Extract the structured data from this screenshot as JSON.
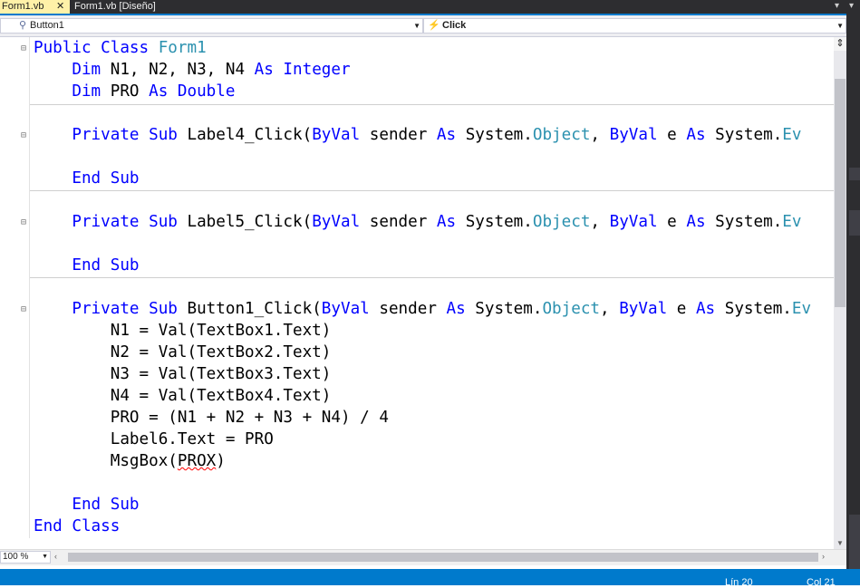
{
  "tabs": {
    "active_label": "Form1.vb",
    "close_glyph": "✕",
    "design_label": "Form1.vb [Diseño]",
    "menu_glyph": "▾"
  },
  "navbar": {
    "object_combo": {
      "icon": "button-control-icon",
      "value": "Button1"
    },
    "event_combo": {
      "icon": "lightning-event-icon",
      "value": "Click"
    }
  },
  "editor": {
    "lines": [
      [
        {
          "t": "Public ",
          "c": "kw"
        },
        {
          "t": "Class ",
          "c": "kw"
        },
        {
          "t": "Form1",
          "c": "ty"
        }
      ],
      [
        {
          "t": "    "
        },
        {
          "t": "Dim",
          "c": "kw"
        },
        {
          "t": " N1, N2, N3, N4 "
        },
        {
          "t": "As",
          "c": "kw"
        },
        {
          "t": " "
        },
        {
          "t": "Integer",
          "c": "kw"
        }
      ],
      [
        {
          "t": "    "
        },
        {
          "t": "Dim",
          "c": "kw"
        },
        {
          "t": " PRO "
        },
        {
          "t": "As",
          "c": "kw"
        },
        {
          "t": " "
        },
        {
          "t": "Double",
          "c": "kw"
        }
      ],
      [],
      [
        {
          "t": "    "
        },
        {
          "t": "Private",
          "c": "kw"
        },
        {
          "t": " "
        },
        {
          "t": "Sub",
          "c": "kw"
        },
        {
          "t": " Label4_Click("
        },
        {
          "t": "ByVal",
          "c": "kw"
        },
        {
          "t": " sender "
        },
        {
          "t": "As",
          "c": "kw"
        },
        {
          "t": " System."
        },
        {
          "t": "Object",
          "c": "ty"
        },
        {
          "t": ", "
        },
        {
          "t": "ByVal",
          "c": "kw"
        },
        {
          "t": " e "
        },
        {
          "t": "As",
          "c": "kw"
        },
        {
          "t": " System."
        },
        {
          "t": "Ev",
          "c": "ty"
        }
      ],
      [],
      [
        {
          "t": "    "
        },
        {
          "t": "End",
          "c": "kw"
        },
        {
          "t": " "
        },
        {
          "t": "Sub",
          "c": "kw"
        }
      ],
      [],
      [
        {
          "t": "    "
        },
        {
          "t": "Private",
          "c": "kw"
        },
        {
          "t": " "
        },
        {
          "t": "Sub",
          "c": "kw"
        },
        {
          "t": " Label5_Click("
        },
        {
          "t": "ByVal",
          "c": "kw"
        },
        {
          "t": " sender "
        },
        {
          "t": "As",
          "c": "kw"
        },
        {
          "t": " System."
        },
        {
          "t": "Object",
          "c": "ty"
        },
        {
          "t": ", "
        },
        {
          "t": "ByVal",
          "c": "kw"
        },
        {
          "t": " e "
        },
        {
          "t": "As",
          "c": "kw"
        },
        {
          "t": " System."
        },
        {
          "t": "Ev",
          "c": "ty"
        }
      ],
      [],
      [
        {
          "t": "    "
        },
        {
          "t": "End",
          "c": "kw"
        },
        {
          "t": " "
        },
        {
          "t": "Sub",
          "c": "kw"
        }
      ],
      [],
      [
        {
          "t": "    "
        },
        {
          "t": "Private",
          "c": "kw"
        },
        {
          "t": " "
        },
        {
          "t": "Sub",
          "c": "kw"
        },
        {
          "t": " Button1_Click("
        },
        {
          "t": "ByVal",
          "c": "kw"
        },
        {
          "t": " sender "
        },
        {
          "t": "As",
          "c": "kw"
        },
        {
          "t": " System."
        },
        {
          "t": "Object",
          "c": "ty"
        },
        {
          "t": ", "
        },
        {
          "t": "ByVal",
          "c": "kw"
        },
        {
          "t": " e "
        },
        {
          "t": "As",
          "c": "kw"
        },
        {
          "t": " System."
        },
        {
          "t": "Ev",
          "c": "ty"
        }
      ],
      [
        {
          "t": "        N1 = Val(TextBox1.Text)"
        }
      ],
      [
        {
          "t": "        N2 = Val(TextBox2.Text)"
        }
      ],
      [
        {
          "t": "        N3 = Val(TextBox3.Text)"
        }
      ],
      [
        {
          "t": "        N4 = Val(TextBox4.Text)"
        }
      ],
      [
        {
          "t": "        PRO = (N1 + N2 + N3 + N4) / 4"
        }
      ],
      [
        {
          "t": "        Label6.Text = PRO"
        }
      ],
      [
        {
          "t": "        MsgBox(PROX)"
        }
      ],
      [],
      [
        {
          "t": "    "
        },
        {
          "t": "End",
          "c": "kw"
        },
        {
          "t": " "
        },
        {
          "t": "Sub",
          "c": "kw"
        }
      ],
      [
        {
          "t": "End",
          "c": "kw"
        },
        {
          "t": " "
        },
        {
          "t": "Class",
          "c": "kw"
        }
      ]
    ],
    "error_token": "PROX",
    "colors": {
      "keyword": "#0000ff",
      "type": "#2b91af",
      "text": "#000000",
      "error_squiggle": "#ff0000"
    }
  },
  "scrollbar": {
    "split_glyph": "⇕",
    "down_glyph": "▼"
  },
  "bottombar": {
    "zoom": "100 %",
    "zoom_arrow": "▼",
    "left_glyph": "‹",
    "right_glyph": "›"
  },
  "status": {
    "line": "Lín 20",
    "col": "Col 21"
  },
  "accent_color": "#007acc"
}
